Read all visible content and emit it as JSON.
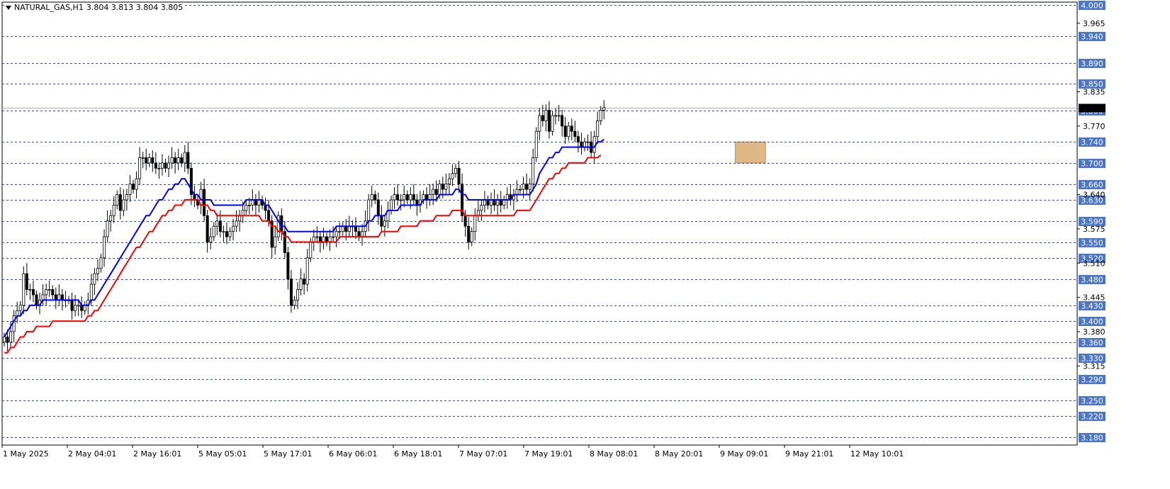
{
  "header": {
    "symbol": "NATURAL_GAS,H1",
    "ohlc": "3.804 3.813 3.804 3.805"
  },
  "chart_data": {
    "type": "candlestick",
    "symbol": "NATURAL_GAS",
    "timeframe": "H1",
    "ylim": [
      3.165,
      4.005
    ],
    "price_axis_ticks": [
      "3.965",
      "3.835",
      "3.770",
      "3.640",
      "3.575",
      "3.510",
      "3.445",
      "3.380",
      "3.315"
    ],
    "horizontal_levels": [
      {
        "price": 4.0,
        "label": "4.000"
      },
      {
        "price": 3.94,
        "label": "3.940"
      },
      {
        "price": 3.89,
        "label": "3.890"
      },
      {
        "price": 3.85,
        "label": "3.850"
      },
      {
        "price": 3.8,
        "label": "3.800"
      },
      {
        "price": 3.74,
        "label": "3.740"
      },
      {
        "price": 3.7,
        "label": "3.700"
      },
      {
        "price": 3.66,
        "label": "3.660"
      },
      {
        "price": 3.63,
        "label": "3.630"
      },
      {
        "price": 3.59,
        "label": "3.590"
      },
      {
        "price": 3.55,
        "label": "3.550"
      },
      {
        "price": 3.52,
        "label": "3.520"
      },
      {
        "price": 3.48,
        "label": "3.480"
      },
      {
        "price": 3.43,
        "label": "3.430"
      },
      {
        "price": 3.4,
        "label": "3.400"
      },
      {
        "price": 3.36,
        "label": "3.360"
      },
      {
        "price": 3.33,
        "label": "3.330"
      },
      {
        "price": 3.29,
        "label": "3.290"
      },
      {
        "price": 3.25,
        "label": "3.250"
      },
      {
        "price": 3.22,
        "label": "3.220"
      },
      {
        "price": 3.18,
        "label": "3.180"
      }
    ],
    "current_price": 3.805,
    "time_labels": [
      "1 May 2025",
      "2 May 04:01",
      "2 May 16:01",
      "5 May 05:01",
      "5 May 17:01",
      "6 May 06:01",
      "6 May 18:01",
      "7 May 07:01",
      "7 May 19:01",
      "8 May 08:01",
      "8 May 20:01",
      "9 May 09:01",
      "9 May 21:01",
      "12 May 10:01"
    ],
    "zone": {
      "x_from": 3.41,
      "x_to": 3.55,
      "y_low": 3.7,
      "y_high": 3.74,
      "color": "#deb887"
    },
    "candle_up_color": "#ffffff",
    "candle_down_color": "#000000",
    "closes": [
      3.37,
      3.36,
      3.38,
      3.41,
      3.42,
      3.43,
      3.49,
      3.46,
      3.46,
      3.45,
      3.43,
      3.44,
      3.45,
      3.46,
      3.46,
      3.45,
      3.44,
      3.45,
      3.44,
      3.44,
      3.44,
      3.42,
      3.43,
      3.43,
      3.42,
      3.43,
      3.44,
      3.47,
      3.49,
      3.5,
      3.52,
      3.56,
      3.59,
      3.6,
      3.62,
      3.64,
      3.61,
      3.63,
      3.64,
      3.66,
      3.65,
      3.67,
      3.71,
      3.71,
      3.7,
      3.71,
      3.7,
      3.69,
      3.69,
      3.7,
      3.69,
      3.7,
      3.71,
      3.7,
      3.71,
      3.7,
      3.72,
      3.69,
      3.64,
      3.63,
      3.62,
      3.65,
      3.6,
      3.55,
      3.56,
      3.58,
      3.59,
      3.57,
      3.57,
      3.56,
      3.57,
      3.58,
      3.59,
      3.6,
      3.61,
      3.62,
      3.62,
      3.63,
      3.62,
      3.63,
      3.62,
      3.61,
      3.59,
      3.54,
      3.56,
      3.6,
      3.57,
      3.53,
      3.48,
      3.43,
      3.44,
      3.46,
      3.48,
      3.47,
      3.52,
      3.55,
      3.56,
      3.56,
      3.55,
      3.56,
      3.55,
      3.56,
      3.56,
      3.57,
      3.57,
      3.58,
      3.57,
      3.58,
      3.58,
      3.57,
      3.56,
      3.57,
      3.59,
      3.63,
      3.64,
      3.63,
      3.6,
      3.58,
      3.59,
      3.61,
      3.63,
      3.64,
      3.63,
      3.63,
      3.64,
      3.63,
      3.64,
      3.63,
      3.62,
      3.63,
      3.64,
      3.63,
      3.64,
      3.65,
      3.64,
      3.66,
      3.65,
      3.66,
      3.67,
      3.68,
      3.69,
      3.66,
      3.6,
      3.58,
      3.55,
      3.57,
      3.6,
      3.61,
      3.62,
      3.63,
      3.62,
      3.63,
      3.62,
      3.63,
      3.62,
      3.63,
      3.64,
      3.63,
      3.64,
      3.65,
      3.65,
      3.66,
      3.65,
      3.66,
      3.71,
      3.76,
      3.79,
      3.78,
      3.8,
      3.76,
      3.79,
      3.79,
      3.79,
      3.77,
      3.75,
      3.77,
      3.76,
      3.75,
      3.74,
      3.73,
      3.74,
      3.74,
      3.72,
      3.75,
      3.78,
      3.8,
      3.805
    ],
    "ma_series": [
      {
        "color": "#0000ff",
        "values": [
          3.37,
          3.38,
          3.39,
          3.4,
          3.41,
          3.41,
          3.42,
          3.42,
          3.43,
          3.43,
          3.43,
          3.43,
          3.44,
          3.44,
          3.44,
          3.44,
          3.44,
          3.44,
          3.44,
          3.44,
          3.44,
          3.44,
          3.44,
          3.44,
          3.43,
          3.43,
          3.43,
          3.44,
          3.44,
          3.45,
          3.46,
          3.47,
          3.48,
          3.49,
          3.5,
          3.51,
          3.52,
          3.53,
          3.54,
          3.55,
          3.56,
          3.57,
          3.58,
          3.59,
          3.6,
          3.6,
          3.61,
          3.62,
          3.63,
          3.63,
          3.64,
          3.65,
          3.65,
          3.66,
          3.66,
          3.67,
          3.67,
          3.66,
          3.65,
          3.64,
          3.64,
          3.63,
          3.63,
          3.63,
          3.63,
          3.62,
          3.62,
          3.62,
          3.62,
          3.62,
          3.62,
          3.62,
          3.62,
          3.62,
          3.62,
          3.63,
          3.63,
          3.63,
          3.63,
          3.63,
          3.63,
          3.62,
          3.62,
          3.61,
          3.6,
          3.59,
          3.58,
          3.58,
          3.57,
          3.57,
          3.57,
          3.57,
          3.57,
          3.57,
          3.57,
          3.57,
          3.57,
          3.57,
          3.57,
          3.57,
          3.57,
          3.57,
          3.57,
          3.58,
          3.58,
          3.58,
          3.58,
          3.58,
          3.58,
          3.58,
          3.58,
          3.58,
          3.58,
          3.59,
          3.59,
          3.6,
          3.6,
          3.6,
          3.6,
          3.61,
          3.61,
          3.61,
          3.61,
          3.62,
          3.62,
          3.62,
          3.62,
          3.62,
          3.62,
          3.62,
          3.63,
          3.63,
          3.63,
          3.63,
          3.63,
          3.64,
          3.64,
          3.64,
          3.64,
          3.64,
          3.65,
          3.65,
          3.64,
          3.64,
          3.63,
          3.63,
          3.63,
          3.63,
          3.63,
          3.63,
          3.63,
          3.63,
          3.63,
          3.63,
          3.63,
          3.63,
          3.63,
          3.63,
          3.64,
          3.64,
          3.64,
          3.64,
          3.64,
          3.64,
          3.65,
          3.66,
          3.68,
          3.69,
          3.7,
          3.71,
          3.71,
          3.72,
          3.72,
          3.73,
          3.73,
          3.73,
          3.73,
          3.73,
          3.73,
          3.73,
          3.73,
          3.73,
          3.73,
          3.73,
          3.74,
          3.74,
          3.745
        ]
      },
      {
        "color": "#ff0000",
        "values": [
          3.34,
          3.34,
          3.35,
          3.35,
          3.36,
          3.37,
          3.37,
          3.38,
          3.38,
          3.38,
          3.39,
          3.39,
          3.39,
          3.39,
          3.39,
          3.4,
          3.4,
          3.4,
          3.4,
          3.4,
          3.4,
          3.4,
          3.4,
          3.4,
          3.4,
          3.4,
          3.41,
          3.41,
          3.42,
          3.42,
          3.43,
          3.44,
          3.45,
          3.46,
          3.47,
          3.48,
          3.49,
          3.5,
          3.51,
          3.52,
          3.53,
          3.54,
          3.54,
          3.55,
          3.56,
          3.57,
          3.57,
          3.58,
          3.59,
          3.6,
          3.6,
          3.61,
          3.61,
          3.62,
          3.62,
          3.62,
          3.63,
          3.63,
          3.63,
          3.63,
          3.63,
          3.62,
          3.62,
          3.62,
          3.61,
          3.61,
          3.6,
          3.6,
          3.6,
          3.6,
          3.6,
          3.6,
          3.6,
          3.6,
          3.6,
          3.6,
          3.6,
          3.6,
          3.6,
          3.6,
          3.59,
          3.59,
          3.59,
          3.58,
          3.58,
          3.57,
          3.57,
          3.56,
          3.56,
          3.55,
          3.55,
          3.55,
          3.55,
          3.55,
          3.55,
          3.55,
          3.55,
          3.55,
          3.55,
          3.55,
          3.55,
          3.55,
          3.55,
          3.55,
          3.56,
          3.56,
          3.56,
          3.56,
          3.56,
          3.56,
          3.56,
          3.56,
          3.56,
          3.56,
          3.56,
          3.56,
          3.56,
          3.57,
          3.57,
          3.57,
          3.57,
          3.57,
          3.57,
          3.58,
          3.58,
          3.58,
          3.58,
          3.58,
          3.58,
          3.59,
          3.59,
          3.59,
          3.59,
          3.59,
          3.6,
          3.6,
          3.6,
          3.6,
          3.6,
          3.61,
          3.61,
          3.61,
          3.61,
          3.6,
          3.6,
          3.6,
          3.6,
          3.6,
          3.6,
          3.6,
          3.6,
          3.6,
          3.6,
          3.6,
          3.6,
          3.6,
          3.6,
          3.6,
          3.6,
          3.61,
          3.61,
          3.61,
          3.61,
          3.61,
          3.62,
          3.63,
          3.64,
          3.65,
          3.66,
          3.67,
          3.67,
          3.68,
          3.68,
          3.69,
          3.69,
          3.7,
          3.7,
          3.7,
          3.7,
          3.7,
          3.7,
          3.71,
          3.71,
          3.71,
          3.71,
          3.715
        ]
      }
    ]
  }
}
